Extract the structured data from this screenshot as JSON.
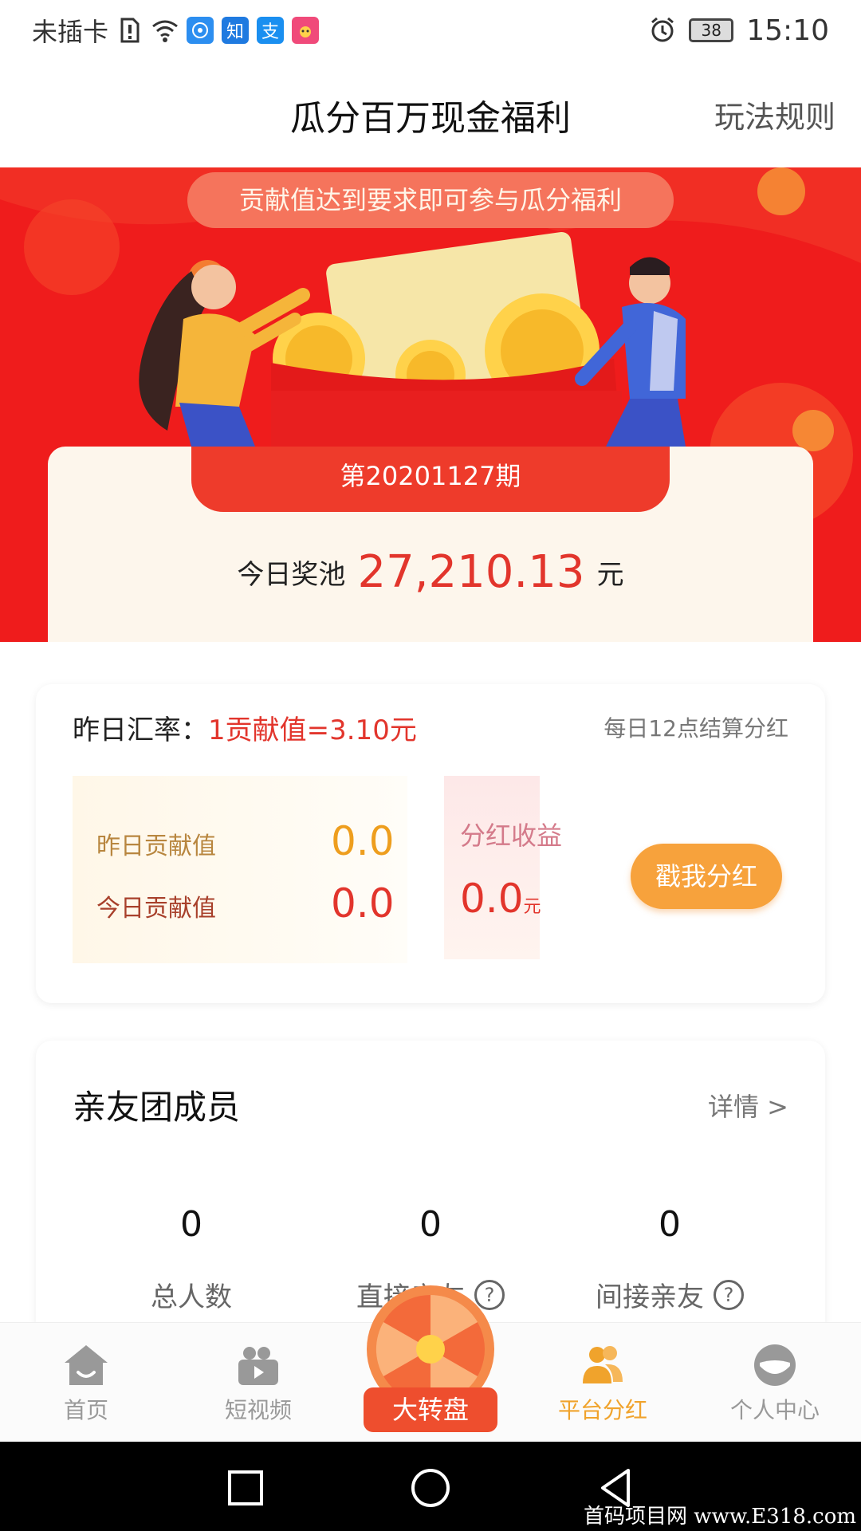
{
  "status_bar": {
    "carrier": "未插卡",
    "apps": [
      "知",
      "支"
    ],
    "battery": "38",
    "time": "15:10"
  },
  "header": {
    "title": "瓜分百万现金福利",
    "rules_link": "玩法规则"
  },
  "banner": {
    "note": "贡献值达到要求即可参与瓜分福利",
    "period": "第20201127期",
    "pool_label": "今日奖池",
    "pool_amount": "27,210.13",
    "pool_unit": "元"
  },
  "dividend": {
    "rate_label": "昨日汇率：",
    "rate_value": "1贡献值=3.10元",
    "settle_note": "每日12点结算分红",
    "yesterday_label": "昨日贡献值",
    "yesterday_value": "0.0",
    "today_label": "今日贡献值",
    "today_value": "0.0",
    "bonus_label": "分红收益",
    "bonus_value": "0.0",
    "bonus_unit": "元",
    "poke_button": "戳我分红"
  },
  "team": {
    "title": "亲友团成员",
    "detail_link": "详情 >",
    "stats": [
      {
        "value": "0",
        "label": "总人数"
      },
      {
        "value": "0",
        "label": "直接亲友"
      },
      {
        "value": "0",
        "label": "间接亲友"
      }
    ]
  },
  "tabbar": {
    "items": [
      {
        "label": "首页",
        "icon": "home-icon"
      },
      {
        "label": "短视频",
        "icon": "video-camera-icon"
      },
      {
        "label": "大转盘",
        "icon": "lucky-wheel-icon"
      },
      {
        "label": "平台分红",
        "icon": "users-icon"
      },
      {
        "label": "个人中心",
        "icon": "profile-icon"
      }
    ],
    "active_color": "#f0a32c",
    "inactive_color": "#999999"
  },
  "watermark": "首码项目网 www.E318.com",
  "colors": {
    "banner_red": "#ef1c1c",
    "accent_red": "#e2352c",
    "accent_orange": "#f7a23c"
  }
}
